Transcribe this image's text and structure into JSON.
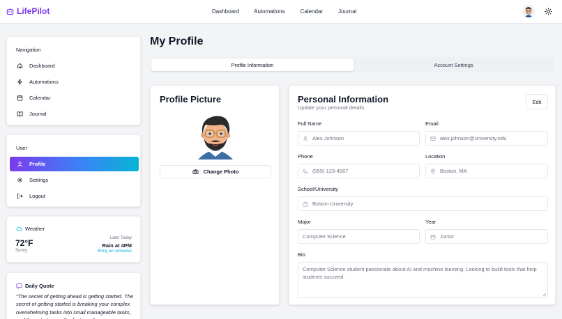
{
  "brand": {
    "name": "LifePilot"
  },
  "nav": [
    "Dashboard",
    "Automations",
    "Calendar",
    "Journal"
  ],
  "sidebar": {
    "navigation_title": "Navigation",
    "navigation_items": [
      "Dashboard",
      "Automations",
      "Calendar",
      "Journal"
    ],
    "user_title": "User",
    "user_items": [
      "Profile",
      "Settings",
      "Logout"
    ],
    "active_item": "Profile"
  },
  "weather": {
    "title": "Weather",
    "temp": "72°F",
    "condition": "Sunny",
    "later_label": "Later Today",
    "forecast": "Rain at 4PM",
    "tip": "Bring an umbrella!"
  },
  "quote": {
    "title": "Daily Quote",
    "text": "\"The secret of getting ahead is getting started. The secret of getting started is breaking your complex overwhelming tasks into small manageable tasks, and then starting on the first one.\""
  },
  "page": {
    "title": "My Profile",
    "tabs": [
      "Profile Information",
      "Account Settings"
    ]
  },
  "profile_picture": {
    "title": "Profile Picture",
    "change_label": "Change Photo"
  },
  "personal": {
    "title": "Personal Information",
    "subtitle": "Update your personal details",
    "edit_label": "Edit",
    "full_name": {
      "label": "Full Name",
      "placeholder": "Alex Johnson"
    },
    "email": {
      "label": "Email",
      "placeholder": "alex.johnson@university.edu"
    },
    "phone": {
      "label": "Phone",
      "placeholder": "(555) 123-4567"
    },
    "location": {
      "label": "Location",
      "placeholder": "Boston, MA"
    },
    "school": {
      "label": "School/University",
      "placeholder": "Boston University"
    },
    "major": {
      "label": "Major",
      "placeholder": "Computer Science"
    },
    "year": {
      "label": "Year",
      "placeholder": "Junior"
    },
    "bio": {
      "label": "Bio",
      "placeholder": "Computer Science student passionate about AI and machine learning. Looking to build tools that help students succeed."
    }
  },
  "colors": {
    "accent": "#7c3aed",
    "accent_blue": "#3b82f6",
    "accent_cyan": "#06b6d4",
    "page_bg": "#f3f4f6"
  },
  "icons": [
    "logo-icon",
    "home-icon",
    "zap-icon",
    "calendar-icon",
    "book-icon",
    "user-icon",
    "gear-icon",
    "logout-icon",
    "cloud-icon",
    "quote-icon",
    "camera-icon",
    "mail-icon",
    "phone-icon",
    "map-pin-icon",
    "building-icon",
    "sun-icon"
  ]
}
